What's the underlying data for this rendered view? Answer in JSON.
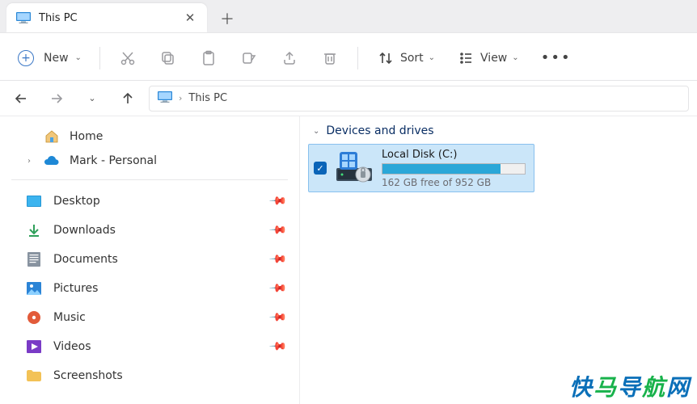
{
  "tab": {
    "title": "This PC"
  },
  "toolbar": {
    "new": "New",
    "sort": "Sort",
    "view": "View"
  },
  "address": {
    "location": "This PC",
    "sep": "›"
  },
  "sidebar": {
    "home": "Home",
    "personal": "Mark - Personal",
    "quick": [
      {
        "key": "desktop",
        "label": "Desktop"
      },
      {
        "key": "downloads",
        "label": "Downloads"
      },
      {
        "key": "documents",
        "label": "Documents"
      },
      {
        "key": "pictures",
        "label": "Pictures"
      },
      {
        "key": "music",
        "label": "Music"
      },
      {
        "key": "videos",
        "label": "Videos"
      },
      {
        "key": "screenshots",
        "label": "Screenshots"
      }
    ]
  },
  "section": {
    "devices": "Devices and drives"
  },
  "drive": {
    "name": "Local Disk (C:)",
    "free_text": "162 GB free of 952 GB",
    "free_gb": 162,
    "total_gb": 952,
    "used_fraction": 0.83
  },
  "watermark": "快马导航网"
}
